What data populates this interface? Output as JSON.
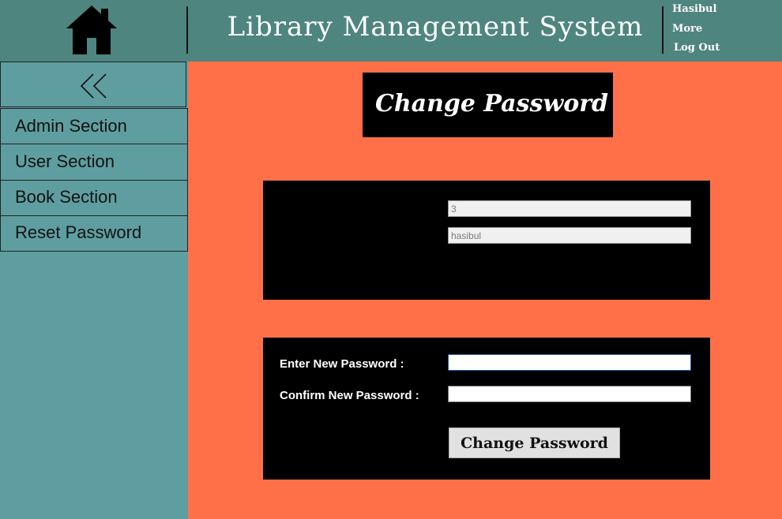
{
  "header": {
    "title": "Library Management System",
    "home_icon": "home-icon",
    "user": {
      "name": "Hasibul",
      "more": "More",
      "logout": "Log Out"
    }
  },
  "sidebar": {
    "collapse_icon": "double-chevron-left-icon",
    "items": [
      {
        "label": "Admin Section"
      },
      {
        "label": "User Section"
      },
      {
        "label": "Book Section"
      },
      {
        "label": "Reset Password"
      }
    ]
  },
  "main": {
    "page_title": "Change Password",
    "account": {
      "id_value": "3",
      "username_value": "hasibul"
    },
    "form": {
      "new_password_label": "Enter New Password :",
      "new_password_value": "",
      "confirm_password_label": "Confirm New Password :",
      "confirm_password_value": "",
      "submit_label": "Change Password"
    }
  },
  "colors": {
    "header_bg": "#4e857f",
    "sidebar_bg": "#5f9ea0",
    "main_bg": "#ff7049",
    "panel_bg": "#000000"
  }
}
